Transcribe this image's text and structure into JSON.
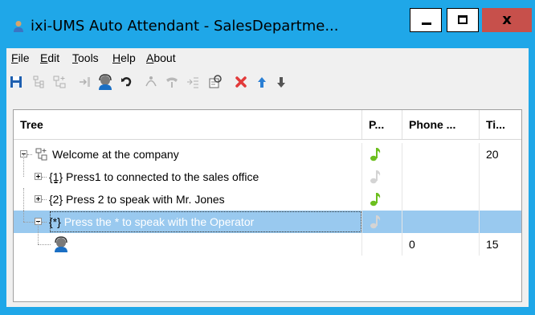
{
  "window": {
    "title": "ixi-UMS Auto Attendant - SalesDepartme...",
    "controls": {
      "minimize": "minimize",
      "maximize": "maximize",
      "close": "x"
    }
  },
  "menu": [
    "File",
    "Edit",
    "Tools",
    "Help",
    "About"
  ],
  "toolbar": [
    "save-icon",
    "tree-node-icon",
    "tree-add-icon",
    "goto-icon",
    "operator-icon",
    "undo-icon",
    "transfer-icon",
    "phone-icon",
    "list-icon",
    "settings-icon",
    "delete-icon",
    "move-up-icon",
    "move-down-icon"
  ],
  "tree": {
    "columns": [
      "Tree",
      "P...",
      "Phone ...",
      "Ti..."
    ],
    "rows": [
      {
        "key": "",
        "text": "Welcome at the company",
        "sound": "green",
        "phone": "",
        "time": "20"
      },
      {
        "key": "{1}",
        "text": "Press1 to connected to the sales office",
        "sound": "gray",
        "phone": "",
        "time": ""
      },
      {
        "key": "{2}",
        "text": "Press 2 to speak with Mr. Jones",
        "sound": "green",
        "phone": "",
        "time": ""
      },
      {
        "key": "{*}",
        "text": "Press the * to speak with the Operator",
        "sound": "gray",
        "phone": "",
        "time": "",
        "selected": true
      },
      {
        "key": "",
        "text": "",
        "sound": "",
        "phone": "0",
        "time": "15"
      }
    ]
  },
  "colors": {
    "titlebar": "#1fa7e8",
    "selection": "#99c9ef",
    "note_green": "#6cbf1e",
    "note_gray": "#d4d4d4",
    "delete_red": "#e23a3a",
    "arrow_blue": "#2a7fd4"
  }
}
